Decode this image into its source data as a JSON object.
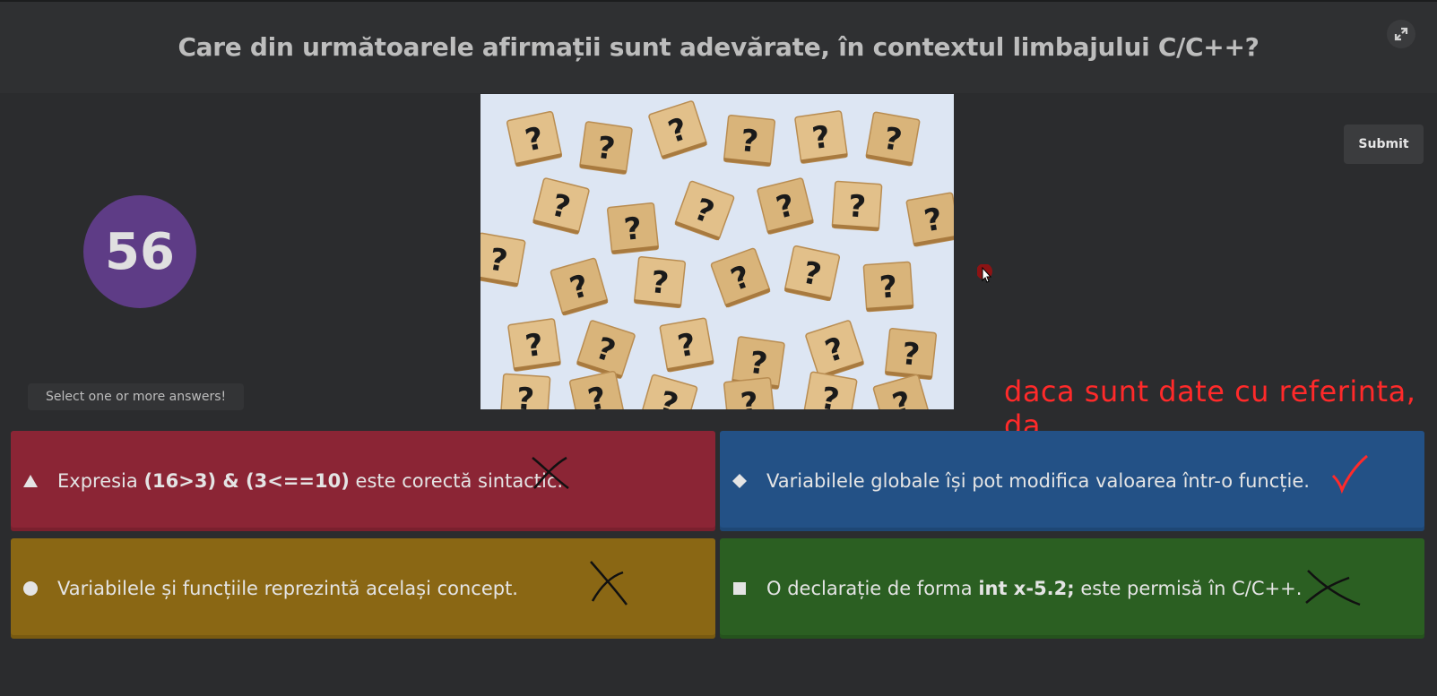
{
  "header": {
    "question": "Care din următoarele afirmații sunt adevărate, în contextul limbajului C/C++?",
    "fullscreen_icon": "expand-icon"
  },
  "controls": {
    "submit_label": "Submit"
  },
  "timer": {
    "value": "56"
  },
  "hint": "Select one or more answers!",
  "media": {
    "icon": "question-mark-tiles-image"
  },
  "annotation": {
    "text": "daca sunt date cu referinta, da",
    "color": "#ff2a2a"
  },
  "answers": [
    {
      "shape": "triangle-icon",
      "color": "#8b2535",
      "parts": [
        "Expresia ",
        "(16>3) & (3<==10)",
        " este corectă sintactic."
      ],
      "mark": "cross"
    },
    {
      "shape": "diamond-icon",
      "color": "#235186",
      "parts": [
        "Variabilele globale își pot modifica valoarea într-o funcție."
      ],
      "mark": "check"
    },
    {
      "shape": "circle-icon",
      "color": "#8a6714",
      "parts": [
        "Variabilele și funcțiile reprezintă același concept."
      ],
      "mark": "cross"
    },
    {
      "shape": "square-icon",
      "color": "#2b5f22",
      "parts": [
        "O declarație de forma ",
        "int x-5.2;",
        " este permisă în C/C++."
      ],
      "mark": "cross"
    }
  ]
}
